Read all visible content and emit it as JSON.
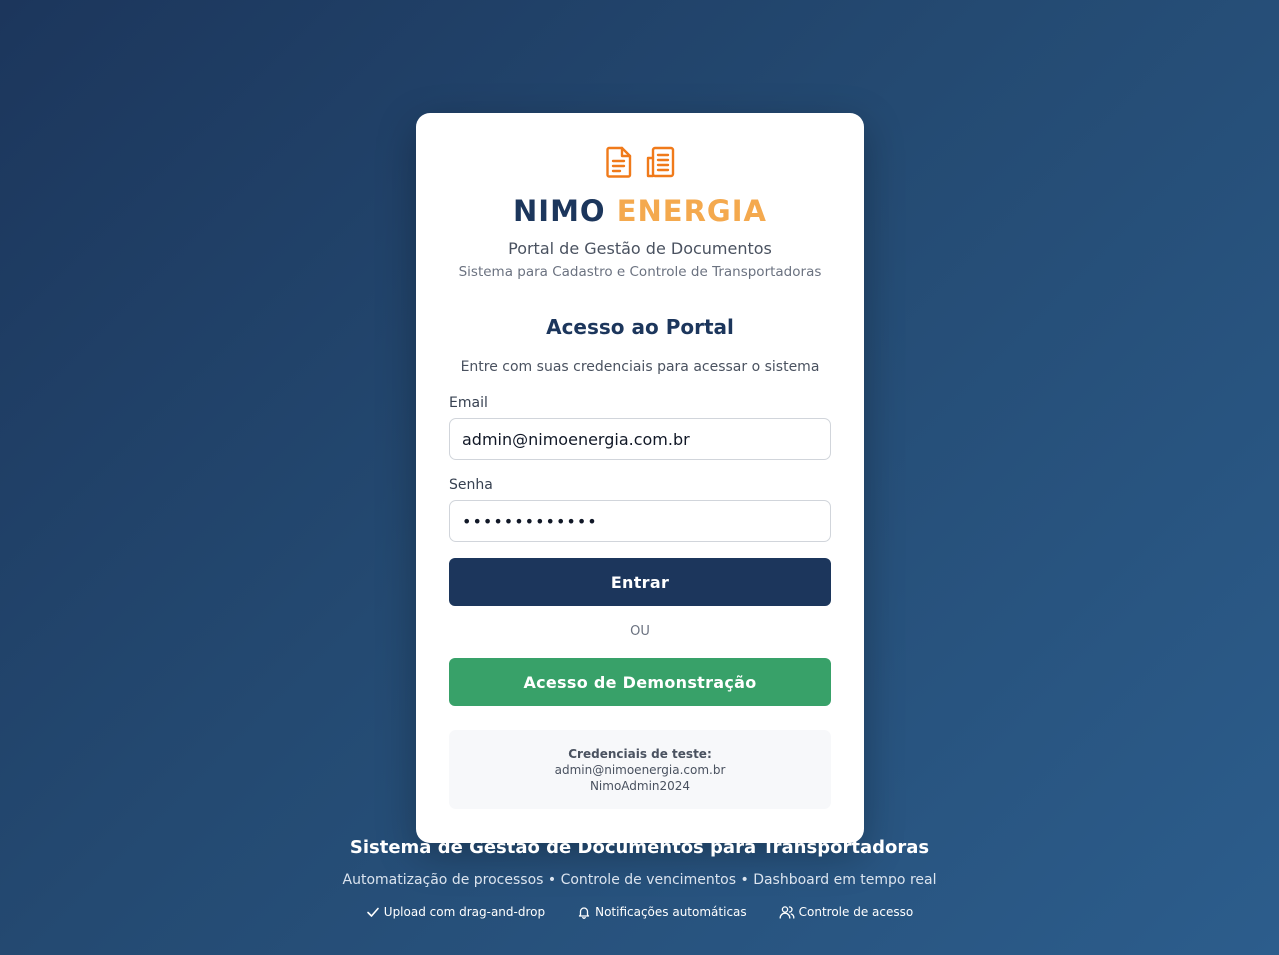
{
  "brand": {
    "name_part1": "NIMO",
    "name_part2": "ENERGIA",
    "subtitle": "Portal de Gestão de Documentos",
    "tagline": "Sistema para Cadastro e Controle de Transportadoras",
    "icons": [
      "document-icon",
      "building-icon"
    ],
    "primary_color": "#1c365c",
    "accent_color": "#f4a94e",
    "icon_color": "#f07a1a"
  },
  "login": {
    "title": "Acesso ao Portal",
    "description": "Entre com suas credenciais para acessar o sistema",
    "email_label": "Email",
    "email_value": "admin@nimoenergia.com.br",
    "password_label": "Senha",
    "password_value": "NimoAdmin2024",
    "submit_label": "Entrar",
    "divider": "OU",
    "demo_label": "Acesso de Demonstração",
    "demo_color": "#38a169"
  },
  "test_credentials": {
    "title": "Credenciais de teste:",
    "email": "admin@nimoenergia.com.br",
    "password": "NimoAdmin2024"
  },
  "footer": {
    "title": "Sistema de Gestão de Documentos para Transportadoras",
    "subtitle": "Automatização de processos • Controle de vencimentos • Dashboard em tempo real",
    "features": [
      {
        "icon": "check-icon",
        "label": "Upload com drag-and-drop"
      },
      {
        "icon": "bell-icon",
        "label": "Notificações automáticas"
      },
      {
        "icon": "users-icon",
        "label": "Controle de acesso"
      }
    ]
  }
}
